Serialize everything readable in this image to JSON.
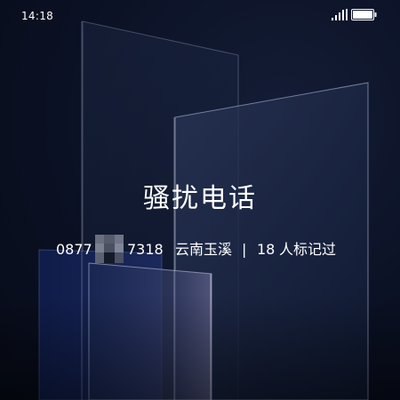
{
  "status_bar": {
    "time": "14:18",
    "signal": "signal-icon",
    "battery": "battery-icon"
  },
  "call_info": {
    "title": "骚扰电话",
    "phone_prefix": "0877",
    "phone_suffix": "7318",
    "location": "云南玉溪",
    "separator": "|",
    "tag_count": "18",
    "tag_label": "人标记过"
  },
  "colors": {
    "background": "#0a1022",
    "text": "#ffffff"
  }
}
